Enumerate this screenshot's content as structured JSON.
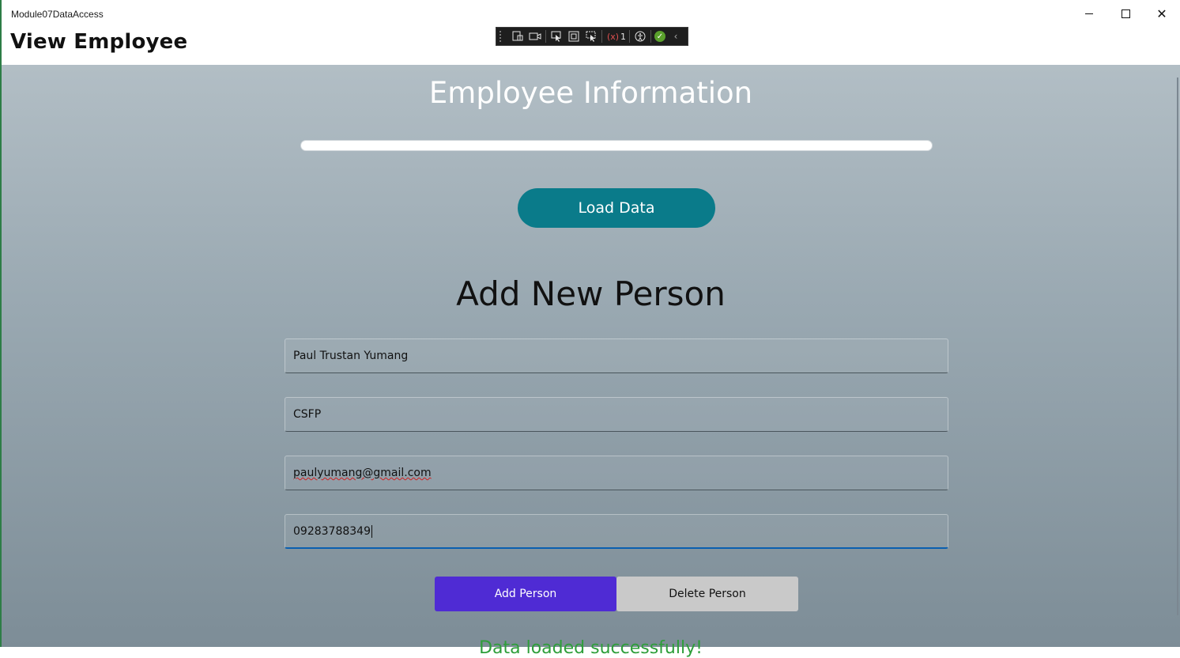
{
  "window": {
    "app_title": "Module07DataAccess",
    "page_header": "View Employee"
  },
  "debug_toolbar": {
    "icons": [
      "live-visual-tree-icon",
      "record-icon",
      "select-element-icon",
      "display-layout-adorners-icon",
      "track-focus-icon",
      "binding-failures-icon",
      "accessibility-icon",
      "hot-reload-check-icon",
      "collapse-chevron-icon"
    ],
    "binding_failure_count": "1"
  },
  "main": {
    "employee_title": "Employee Information",
    "progress": 0,
    "load_button_label": "Load Data",
    "add_title": "Add New Person"
  },
  "form": {
    "name_value": "Paul Trustan Yumang",
    "company_value": "CSFP",
    "email_value": "paulyumang@gmail.com",
    "phone_value": "09283788349"
  },
  "actions": {
    "add_label": "Add Person",
    "delete_label": "Delete Person"
  },
  "status": {
    "text": "Data loaded successfully!"
  },
  "colors": {
    "load_button": "#0a7b8a",
    "add_button": "#4f2bd4",
    "delete_button": "#c9c9c9",
    "status_text": "#2e9e3a"
  }
}
